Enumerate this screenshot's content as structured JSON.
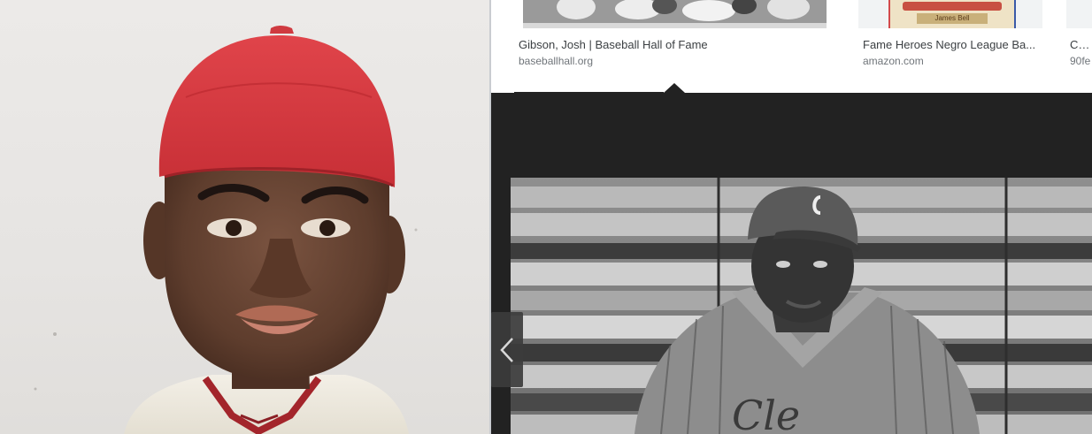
{
  "results": [
    {
      "title": "Gibson, Josh | Baseball Hall of Fame",
      "source": "baseballhall.org"
    },
    {
      "title": "Fame Heroes Negro League Ba...",
      "source": "amazon.com",
      "thumb_caption": "James Bell"
    },
    {
      "title": "Cam",
      "source": "90fe"
    }
  ],
  "navigation": {
    "prev_icon": "chevron-left-icon"
  },
  "colors": {
    "dark_panel": "#222222",
    "cap_red": "#d9393f",
    "title_text": "#3c4043",
    "source_text": "#70757a"
  }
}
